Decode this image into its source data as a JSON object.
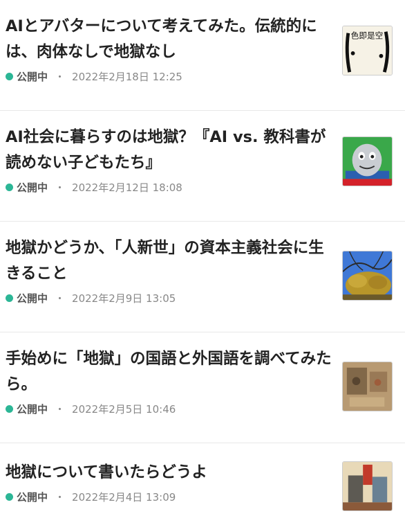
{
  "articles": [
    {
      "title": "AIとアバターについて考えてみた。伝統的には、肉体なしで地獄なし",
      "status": "公開中",
      "separator": "・",
      "date": "2022年2月18日 12:25",
      "thumbnail": "calligraphy-thumbnail",
      "thumbnail_text": "色即是空"
    },
    {
      "title": "AI社会に暮らすのは地獄？『AI vs. 教科書が読めない子どもたち』",
      "status": "公開中",
      "separator": "・",
      "date": "2022年2月12日 18:08",
      "thumbnail": "train-face-thumbnail"
    },
    {
      "title": "地獄かどうか、「人新世」の資本主義社会に生きること",
      "status": "公開中",
      "separator": "・",
      "date": "2022年2月9日 13:05",
      "thumbnail": "tree-sky-thumbnail"
    },
    {
      "title": "手始めに「地獄」の国語と外国語を調べてみたら。",
      "status": "公開中",
      "separator": "・",
      "date": "2022年2月5日 10:46",
      "thumbnail": "old-painting-thumbnail"
    },
    {
      "title": "地獄について書いたらどうよ",
      "status": "公開中",
      "separator": "・",
      "date": "2022年2月4日 13:09",
      "thumbnail": "ukiyoe-thumbnail"
    }
  ],
  "colors": {
    "status_dot": "#2cb696",
    "title": "#222222",
    "meta": "#888888"
  }
}
